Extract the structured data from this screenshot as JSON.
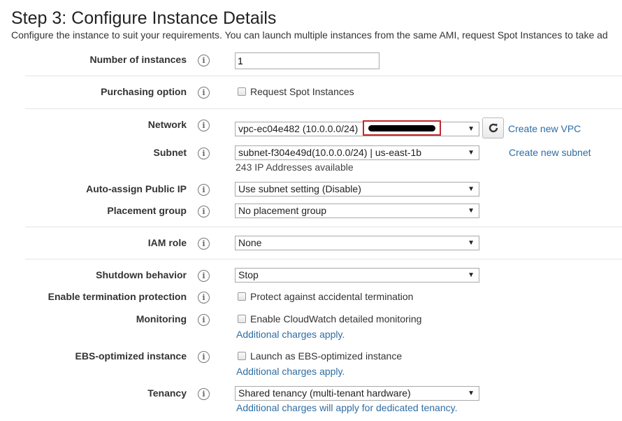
{
  "page": {
    "title": "Step 3: Configure Instance Details",
    "subtitle": "Configure the instance to suit your requirements. You can launch multiple instances from the same AMI, request Spot Instances to take ad"
  },
  "info_icon_glyph": "i",
  "fields": {
    "instances": {
      "label": "Number of instances",
      "value": "1"
    },
    "purchasing": {
      "label": "Purchasing option",
      "checkbox_label": "Request Spot Instances",
      "checked": false
    },
    "network": {
      "label": "Network",
      "value": "vpc-ec04e482 (10.0.0.0/24)",
      "link": "Create new VPC"
    },
    "subnet": {
      "label": "Subnet",
      "value": "subnet-f304e49d(10.0.0.0/24) | us-east-1b",
      "note": "243 IP Addresses available",
      "link": "Create new subnet"
    },
    "public_ip": {
      "label": "Auto-assign Public IP",
      "value": "Use subnet setting (Disable)"
    },
    "placement": {
      "label": "Placement group",
      "value": "No placement group"
    },
    "iam": {
      "label": "IAM role",
      "value": "None"
    },
    "shutdown": {
      "label": "Shutdown behavior",
      "value": "Stop"
    },
    "termination": {
      "label": "Enable termination protection",
      "checkbox_label": "Protect against accidental termination",
      "checked": false
    },
    "monitoring": {
      "label": "Monitoring",
      "checkbox_label": "Enable CloudWatch detailed monitoring",
      "checked": false,
      "link": "Additional charges apply."
    },
    "ebs": {
      "label": "EBS-optimized instance",
      "checkbox_label": "Launch as EBS-optimized instance",
      "checked": false,
      "link": "Additional charges apply."
    },
    "tenancy": {
      "label": "Tenancy",
      "value": "Shared tenancy (multi-tenant hardware)",
      "link": "Additional charges will apply for dedicated tenancy."
    }
  },
  "colors": {
    "link": "#2e6da4",
    "redaction_border": "#c1272d"
  }
}
